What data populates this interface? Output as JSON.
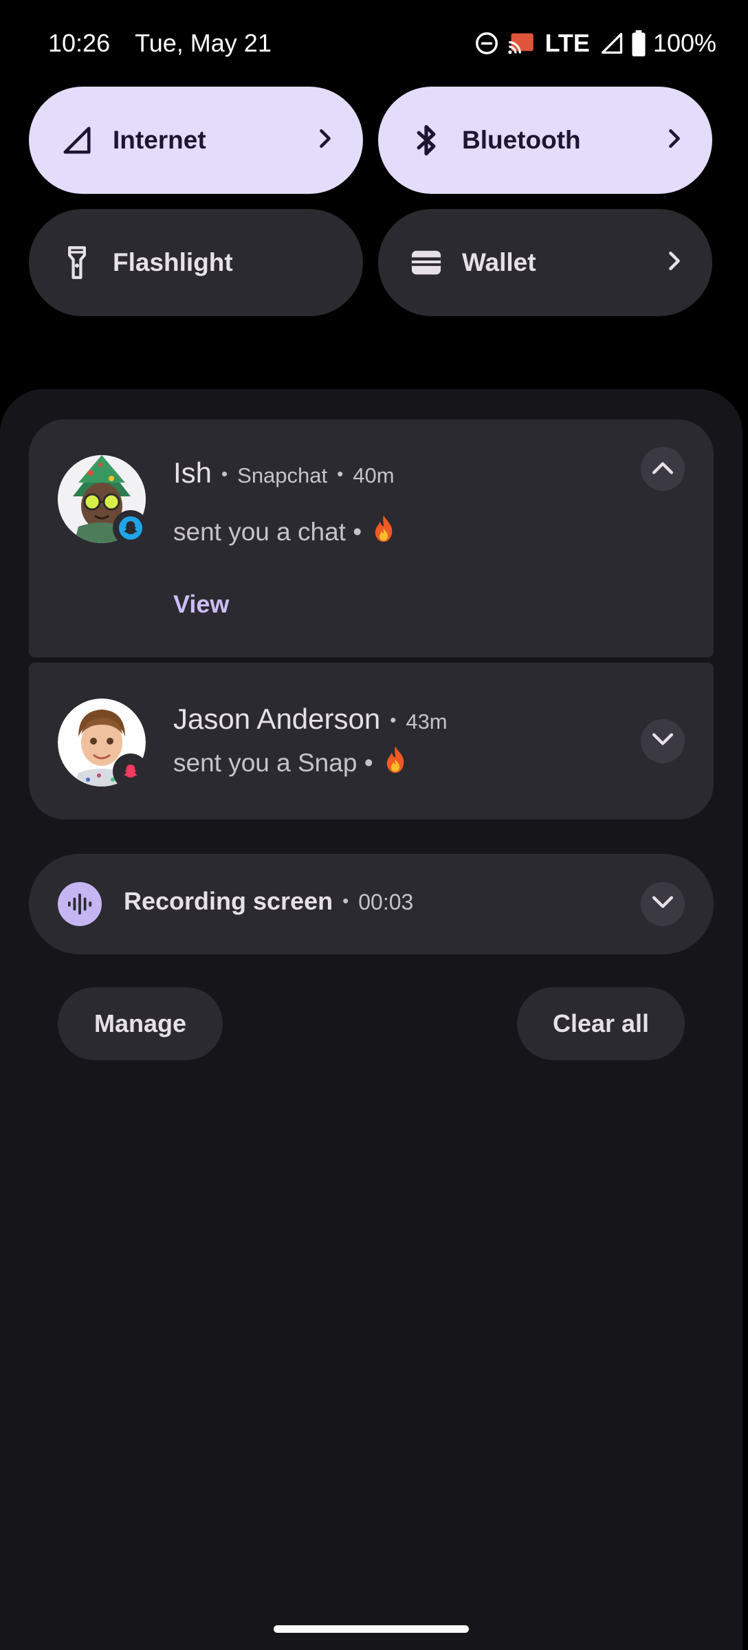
{
  "status_bar": {
    "time": "10:26",
    "date": "Tue, May 21",
    "network": "LTE",
    "battery": "100%",
    "icons": [
      "do-not-disturb-icon",
      "cast-icon",
      "signal-icon",
      "battery-icon"
    ]
  },
  "quick_tiles": [
    {
      "label": "Internet",
      "icon": "signal-icon",
      "state": "on",
      "has_chevron": true
    },
    {
      "label": "Bluetooth",
      "icon": "bluetooth-icon",
      "state": "on",
      "has_chevron": true
    },
    {
      "label": "Flashlight",
      "icon": "flashlight-icon",
      "state": "off",
      "has_chevron": false
    },
    {
      "label": "Wallet",
      "icon": "wallet-icon",
      "state": "off",
      "has_chevron": true
    }
  ],
  "notifications": [
    {
      "sender": "Ish",
      "app": "Snapchat",
      "time": "40m",
      "message": "sent you a chat •",
      "emoji": "🔥",
      "action": "View",
      "badge_color": "#1fa5e8",
      "expanded": true
    },
    {
      "sender": "Jason Anderson",
      "time": "43m",
      "message": "sent you a Snap •",
      "emoji": "🔥",
      "badge_color": "#f03a5f",
      "expanded": false
    }
  ],
  "recording": {
    "title": "Recording screen",
    "elapsed": "00:03"
  },
  "buttons": {
    "manage": "Manage",
    "clear_all": "Clear all"
  },
  "colors": {
    "tile_on": "#e4dcfb",
    "tile_off": "#2b2a30",
    "shade_bg": "#16151a",
    "accent": "#cbbdf7"
  }
}
